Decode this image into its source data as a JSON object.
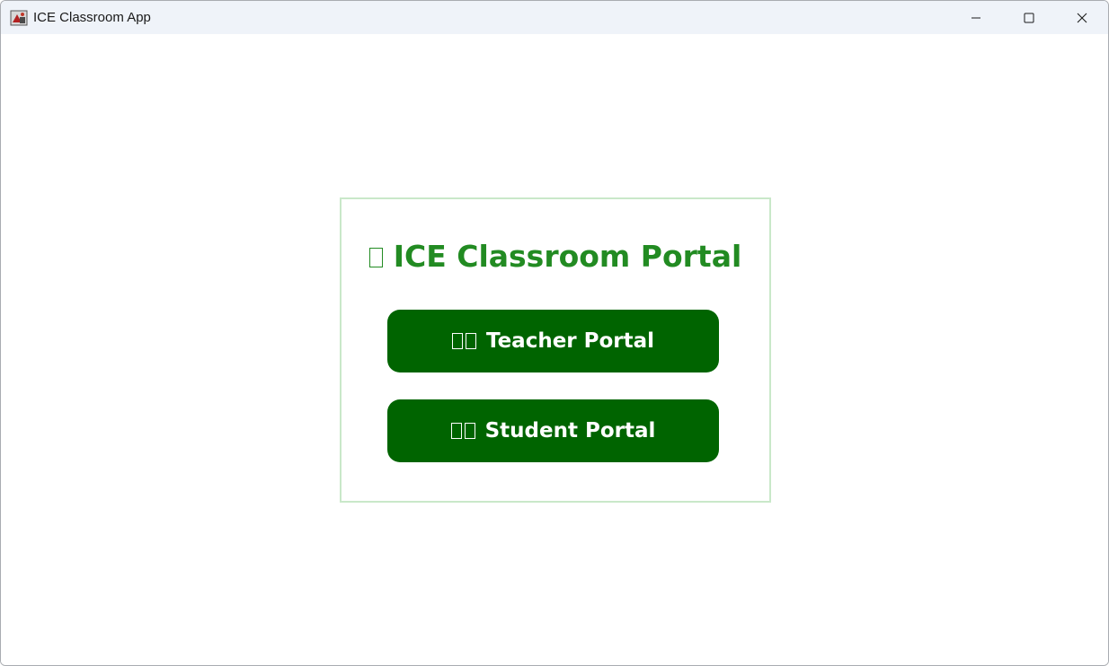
{
  "window": {
    "title": "ICE Classroom App"
  },
  "portal": {
    "title": "ICE Classroom Portal",
    "title_icon": "missing-glyph-icon",
    "teacher_button_label": "Teacher Portal",
    "student_button_label": "Student Portal"
  },
  "colors": {
    "accent": "#228b22",
    "button_bg": "#006400",
    "panel_border": "#c9e8c9",
    "titlebar_bg": "#eff3f9"
  }
}
